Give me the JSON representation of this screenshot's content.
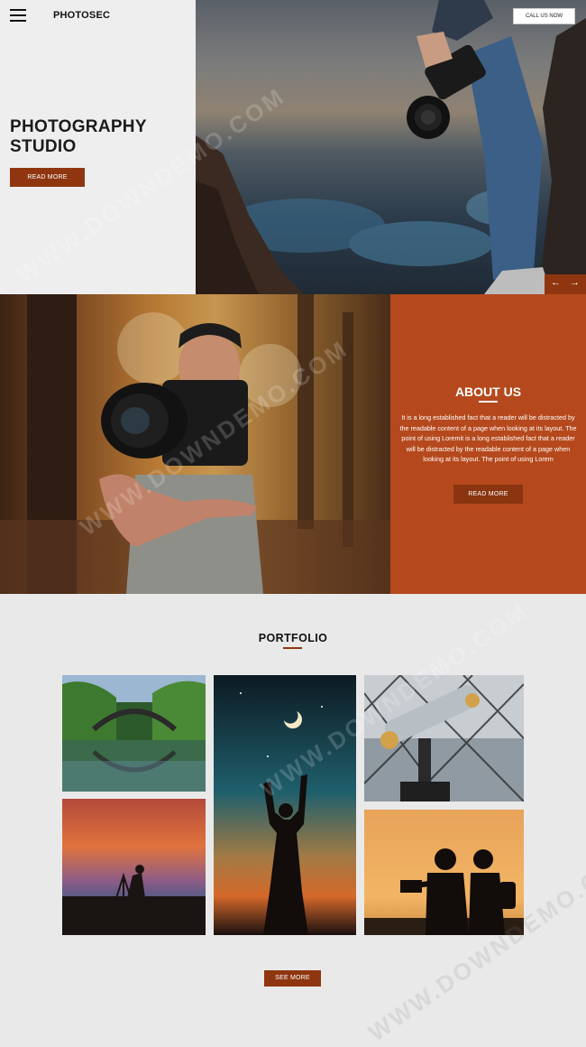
{
  "header": {
    "brand": "PHOTOSEC",
    "call_button": "CALL US NOW"
  },
  "hero": {
    "title_line1": "PHOTOGRAPHY",
    "title_line2": "STUDIO",
    "read_more": "READ MORE",
    "arrow_prev": "←",
    "arrow_next": "→"
  },
  "about": {
    "title": "ABOUT US",
    "text": "It is a long established fact that a reader will be distracted by the readable content of a page when looking at its layout. The point of using Loremit is a long established fact that a reader will be distracted by the readable content of a page when looking at its layout. The point of using Lorem",
    "read_more": "READ MORE"
  },
  "portfolio": {
    "title": "PORTFOLIO",
    "see_more": "SEE MORE"
  },
  "watermark": "WWW.DOWNDEMO.COM",
  "colors": {
    "accent": "#8f3610",
    "about_panel": "#b5491d",
    "page_bg": "#e9e9e9"
  }
}
